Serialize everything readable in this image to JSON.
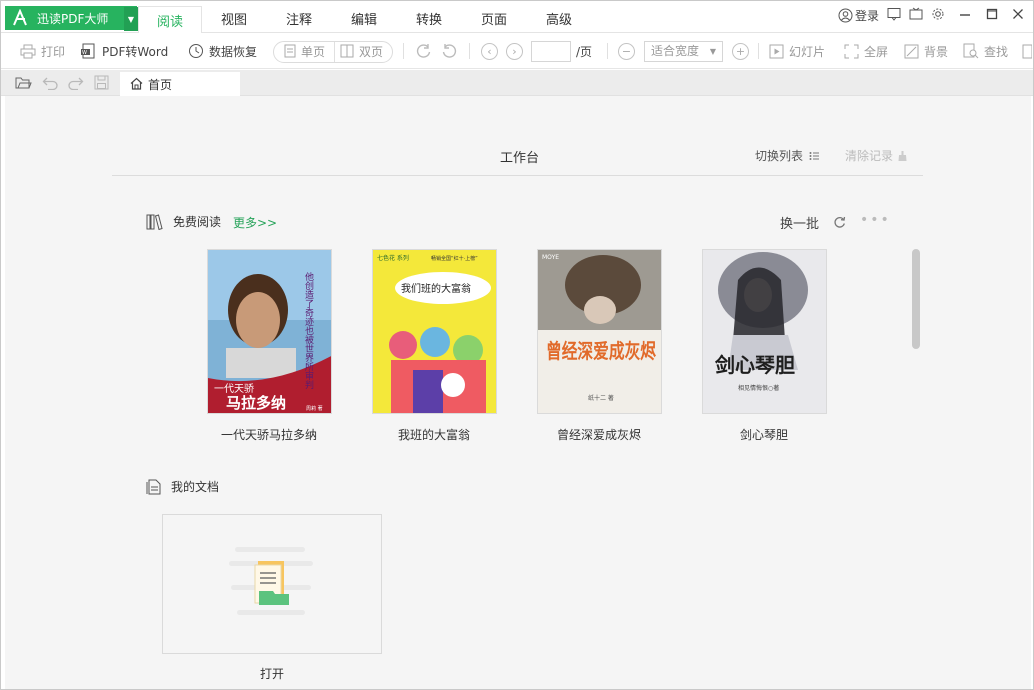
{
  "app": {
    "brand": "迅读PDF大师"
  },
  "menu": {
    "items": [
      "阅读",
      "视图",
      "注释",
      "编辑",
      "转换",
      "页面",
      "高级"
    ],
    "active": "阅读"
  },
  "window": {
    "login": "登录"
  },
  "toolbar": {
    "print": "打印",
    "pdf_to_word": "PDF转Word",
    "data_recovery": "数据恢复",
    "single_page": "单页",
    "double_page": "双页",
    "page_suffix": "/页",
    "page_value": "",
    "zoom_value": "适合宽度",
    "slideshow": "幻灯片",
    "fullscreen": "全屏",
    "background": "背景",
    "find": "查找"
  },
  "tabs": {
    "home": "首页"
  },
  "workspace": {
    "title": "工作台",
    "switch_list": "切换列表",
    "clear_records": "清除记录"
  },
  "free_reading": {
    "title": "免费阅读",
    "more": "更多>>",
    "change_batch": "换一批",
    "books": [
      {
        "title": "一代天骄马拉多纳",
        "cover_main": "马拉多纳",
        "cover_sub": "一代天骄",
        "cover_side": "他创造了奇迹也被世界所审判",
        "cover_small": "周莉 著"
      },
      {
        "title": "我班的大富翁",
        "cover_main": "我们班的大富翁",
        "cover_top": "畅销全国“红十·上榜”",
        "cover_brand": "七色花 系列"
      },
      {
        "title": "曾经深爱成灰烬",
        "cover_main": "曾经深爱成灰烬",
        "cover_author": "纸十二 著",
        "cover_brand": "MOYE"
      },
      {
        "title": "剑心琴胆",
        "cover_main": "剑心琴胆",
        "cover_author": "相见情悔恨○著"
      }
    ]
  },
  "my_docs": {
    "title": "我的文档",
    "open": "打开"
  }
}
